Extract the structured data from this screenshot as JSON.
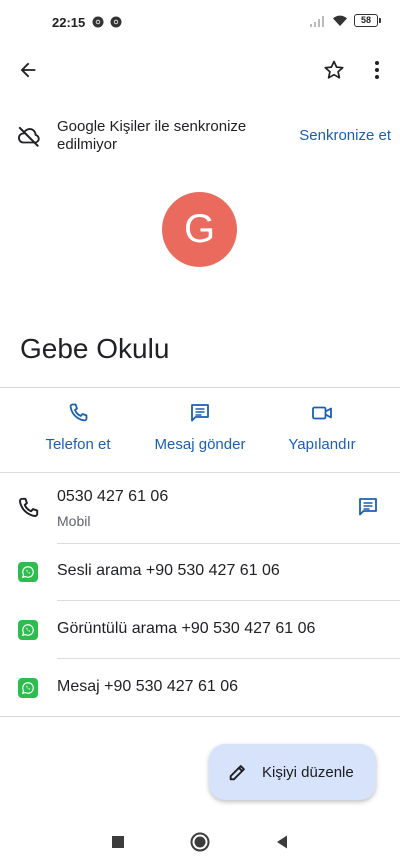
{
  "status_bar": {
    "time": "22:15",
    "battery": "58",
    "icons": [
      "chrome-icon",
      "chrome-icon",
      "signal-icon",
      "wifi-icon",
      "battery-icon"
    ]
  },
  "app_bar": {
    "icons": [
      "back-arrow-icon",
      "star-outline-icon",
      "more-vert-icon"
    ]
  },
  "sync_banner": {
    "icon": "cloud-off-icon",
    "text": "Google Kişiler ile senkronize edilmiyor",
    "action": "Senkronize et"
  },
  "contact": {
    "avatar_letter": "G",
    "avatar_color": "#ea6b5e",
    "name": "Gebe Okulu"
  },
  "actions": [
    {
      "label": "Telefon et",
      "icon": "phone-icon"
    },
    {
      "label": "Mesaj gönder",
      "icon": "message-icon"
    },
    {
      "label": "Yapılandır",
      "icon": "videocam-icon"
    }
  ],
  "phone": {
    "number": "0530 427 61 06",
    "type": "Mobil",
    "icon": "phone-icon",
    "action_icon": "message-icon"
  },
  "whatsapp": [
    {
      "label": "Sesli arama +90 530 427 61 06",
      "icon": "whatsapp-icon"
    },
    {
      "label": "Görüntülü arama +90 530 427 61 06",
      "icon": "whatsapp-icon"
    },
    {
      "label": "Mesaj +90 530 427 61 06",
      "icon": "whatsapp-icon"
    }
  ],
  "fab": {
    "label": "Kişiyi düzenle",
    "icon": "edit-pencil-icon"
  },
  "colors": {
    "accent": "#1a5fb4",
    "fab_background": "#d6e3fb",
    "whatsapp": "#2dbd4f"
  },
  "nav_bar": {
    "icons": [
      "recents-square-icon",
      "home-circle-icon",
      "back-triangle-icon"
    ]
  }
}
